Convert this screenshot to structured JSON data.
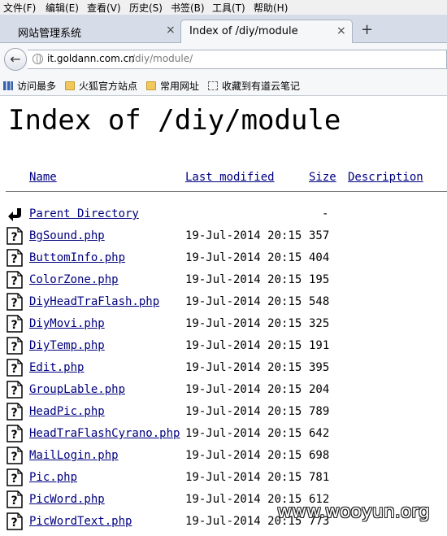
{
  "menu": [
    "文件(F)",
    "编辑(E)",
    "查看(V)",
    "历史(S)",
    "书签(B)",
    "工具(T)",
    "帮助(H)"
  ],
  "tabs": [
    {
      "title": "网站管理系统",
      "close": "×"
    },
    {
      "title": "Index of /diy/module",
      "close": "×"
    }
  ],
  "new_tab": "+",
  "nav": {
    "back": "←",
    "url_host": "it.goldann.com.cn",
    "url_path": "/diy/module/"
  },
  "bookmarks": [
    "访问最多",
    "火狐官方站点",
    "常用网址",
    "收藏到有道云笔记"
  ],
  "page": {
    "heading": "Index of /diy/module",
    "columns": {
      "name": "Name",
      "modified": "Last modified",
      "size": "Size",
      "description": "Description"
    },
    "parent": {
      "name": "Parent Directory",
      "size": "-"
    },
    "files": [
      {
        "name": "BgSound.php",
        "modified": "19-Jul-2014 20:15",
        "size": "357"
      },
      {
        "name": "ButtomInfo.php",
        "modified": "19-Jul-2014 20:15",
        "size": "404"
      },
      {
        "name": "ColorZone.php",
        "modified": "19-Jul-2014 20:15",
        "size": "195"
      },
      {
        "name": "DiyHeadTraFlash.php",
        "modified": "19-Jul-2014 20:15",
        "size": "548"
      },
      {
        "name": "DiyMovi.php",
        "modified": "19-Jul-2014 20:15",
        "size": "325"
      },
      {
        "name": "DiyTemp.php",
        "modified": "19-Jul-2014 20:15",
        "size": "191"
      },
      {
        "name": "Edit.php",
        "modified": "19-Jul-2014 20:15",
        "size": "395"
      },
      {
        "name": "GroupLable.php",
        "modified": "19-Jul-2014 20:15",
        "size": "204"
      },
      {
        "name": "HeadPic.php",
        "modified": "19-Jul-2014 20:15",
        "size": "789"
      },
      {
        "name": "HeadTraFlashCyrano.php",
        "modified": "19-Jul-2014 20:15",
        "size": "642"
      },
      {
        "name": "MailLogin.php",
        "modified": "19-Jul-2014 20:15",
        "size": "698"
      },
      {
        "name": "Pic.php",
        "modified": "19-Jul-2014 20:15",
        "size": "781"
      },
      {
        "name": "PicWord.php",
        "modified": "19-Jul-2014 20:15",
        "size": "612"
      },
      {
        "name": "PicWordText.php",
        "modified": "19-Jul-2014 20:15",
        "size": "773"
      }
    ]
  },
  "watermark": "www.wooyun.org",
  "colors": {
    "link": "#00007f",
    "tab_strip": "#d7dde8",
    "chrome": "#f6f7f9"
  }
}
